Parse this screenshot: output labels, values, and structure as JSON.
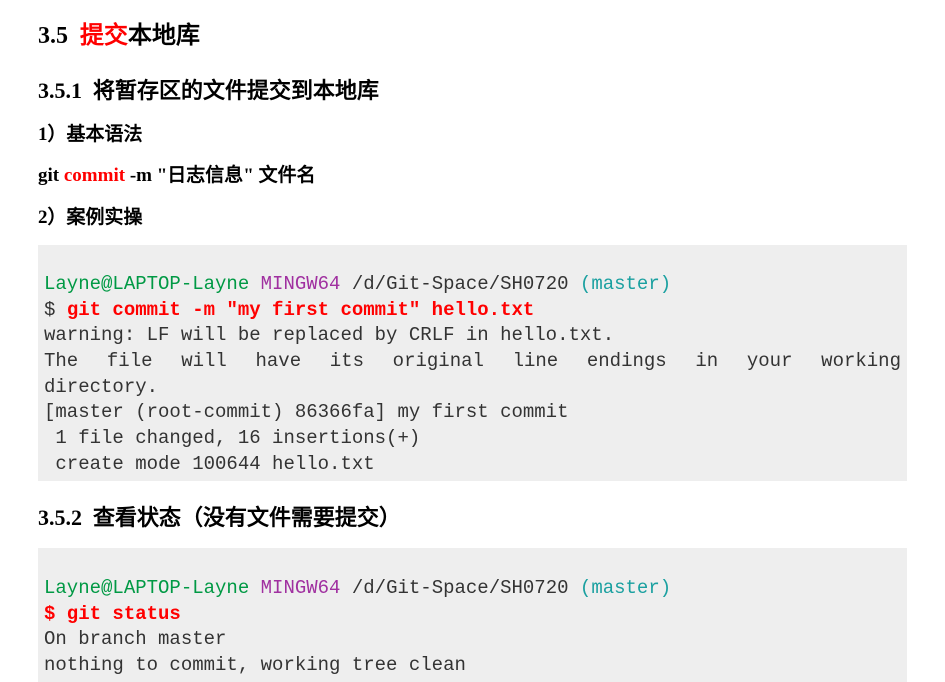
{
  "h35": {
    "num": "3.5",
    "red": "提交",
    "rest": "本地库"
  },
  "h351": {
    "num": "3.5.1",
    "title": "将暂存区的文件提交到本地库"
  },
  "h351_sub1": "1）基本语法",
  "syntax": {
    "pre": "git ",
    "red": "commit",
    "post": " -m \"日志信息\" 文件名"
  },
  "h351_sub2": "2）案例实操",
  "term1": {
    "prompt_user": "Layne@LAPTOP-Layne",
    "prompt_sys": "MINGW64",
    "prompt_path": "/d/Git-Space/SH0720",
    "prompt_branch": "(master)",
    "dollar": "$ ",
    "cmd": "git commit -m \"my first commit\" hello.txt",
    "out1": "warning: LF will be replaced by CRLF in hello.txt.",
    "out2_a": "The file will have its original line endings in your working",
    "out2_b": "directory.",
    "out3": "[master (root-commit) 86366fa] my first commit",
    "out4": " 1 file changed, 16 insertions(+)",
    "out5": " create mode 100644 hello.txt"
  },
  "h352": {
    "num": "3.5.2",
    "title": "查看状态（没有文件需要提交）"
  },
  "term2": {
    "prompt_user": "Layne@LAPTOP-Layne",
    "prompt_sys": "MINGW64",
    "prompt_path": "/d/Git-Space/SH0720",
    "prompt_branch": "(master)",
    "cmd_line": "$ git status",
    "out1": "On branch master",
    "out2": "nothing to commit, working tree clean"
  }
}
